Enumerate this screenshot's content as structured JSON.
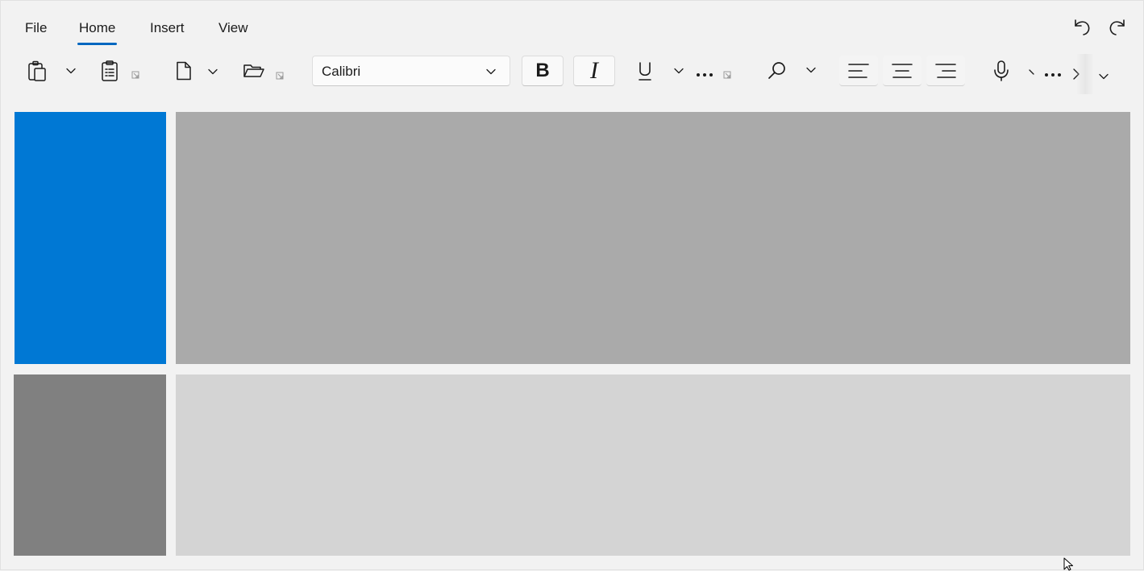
{
  "menu": {
    "tabs": [
      {
        "label": "File"
      },
      {
        "label": "Home",
        "active": true
      },
      {
        "label": "Insert"
      },
      {
        "label": "View"
      }
    ]
  },
  "toolbar": {
    "font_family_value": "Calibri",
    "icons": [
      "paste-icon",
      "clipboard-icon",
      "new-document-icon",
      "open-folder-icon",
      "find-icon",
      "microphone-icon",
      "undo-icon",
      "redo-icon"
    ]
  },
  "panels": {
    "colors": [
      "#0078d4",
      "#aaaaaa",
      "#808080",
      "#d4d4d4"
    ]
  },
  "colors": {
    "accent": "#0067c0"
  }
}
